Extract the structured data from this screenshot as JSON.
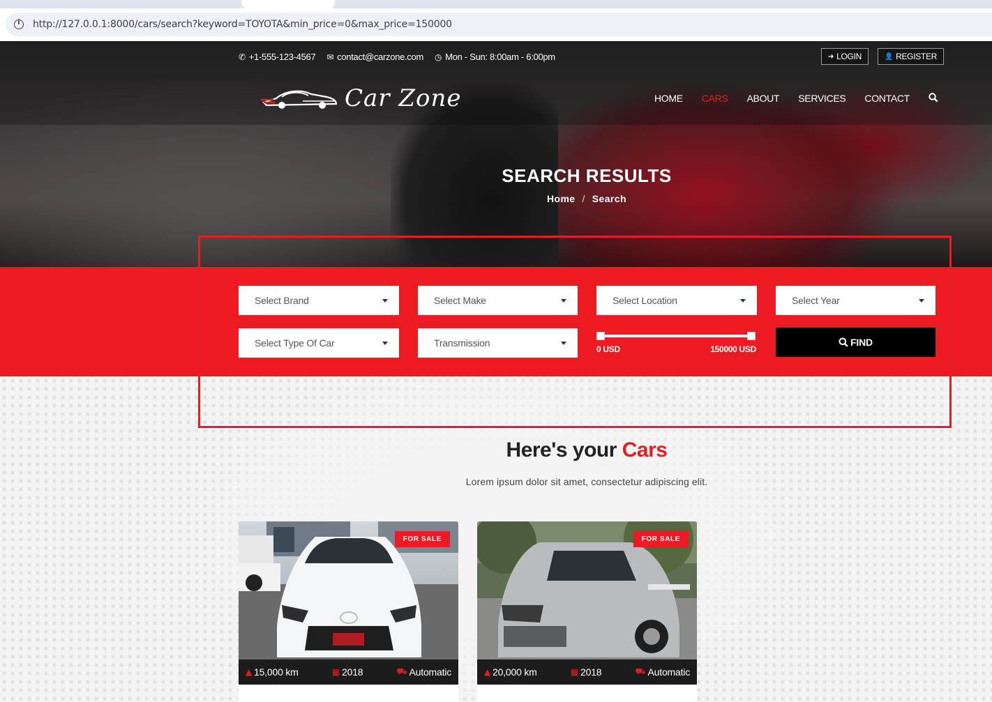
{
  "browser": {
    "url": "http://127.0.0.1:8000/cars/search?keyword=TOYOTA&min_price=0&max_price=150000"
  },
  "topbar": {
    "phone": "+1-555-123-4567",
    "email": "contact@carzone.com",
    "hours": "Mon - Sun: 8:00am - 6:00pm",
    "login_label": "LOGIN",
    "register_label": "REGISTER"
  },
  "logo": {
    "text": "Car Zone"
  },
  "nav": {
    "items": [
      "HOME",
      "CARS",
      "ABOUT",
      "SERVICES",
      "CONTACT"
    ],
    "active": "CARS"
  },
  "hero": {
    "title": "SEARCH RESULTS",
    "breadcrumb": [
      "Home",
      "Search"
    ]
  },
  "search": {
    "brand_placeholder": "Select Brand",
    "make_placeholder": "Select Make",
    "location_placeholder": "Select Location",
    "year_placeholder": "Select Year",
    "type_placeholder": "Select Type Of Car",
    "transmission_placeholder": "Transmission",
    "price_min_label": "0 USD",
    "price_max_label": "150000 USD",
    "price_min": 0,
    "price_max": 150000,
    "find_label": "FIND"
  },
  "results": {
    "title_prefix": "Here's your",
    "title_highlight": "Cars",
    "subtitle": "Lorem ipsum dolor sit amet, consectetur adipiscing elit."
  },
  "cars": [
    {
      "badge": "FOR SALE",
      "mileage": "15,000 km",
      "year": "2018",
      "transmission": "Automatic"
    },
    {
      "badge": "FOR SALE",
      "mileage": "20,000 km",
      "year": "2018",
      "transmission": "Automatic"
    }
  ],
  "colors": {
    "accent": "#ec1b23",
    "dark": "#1c1c1c"
  }
}
